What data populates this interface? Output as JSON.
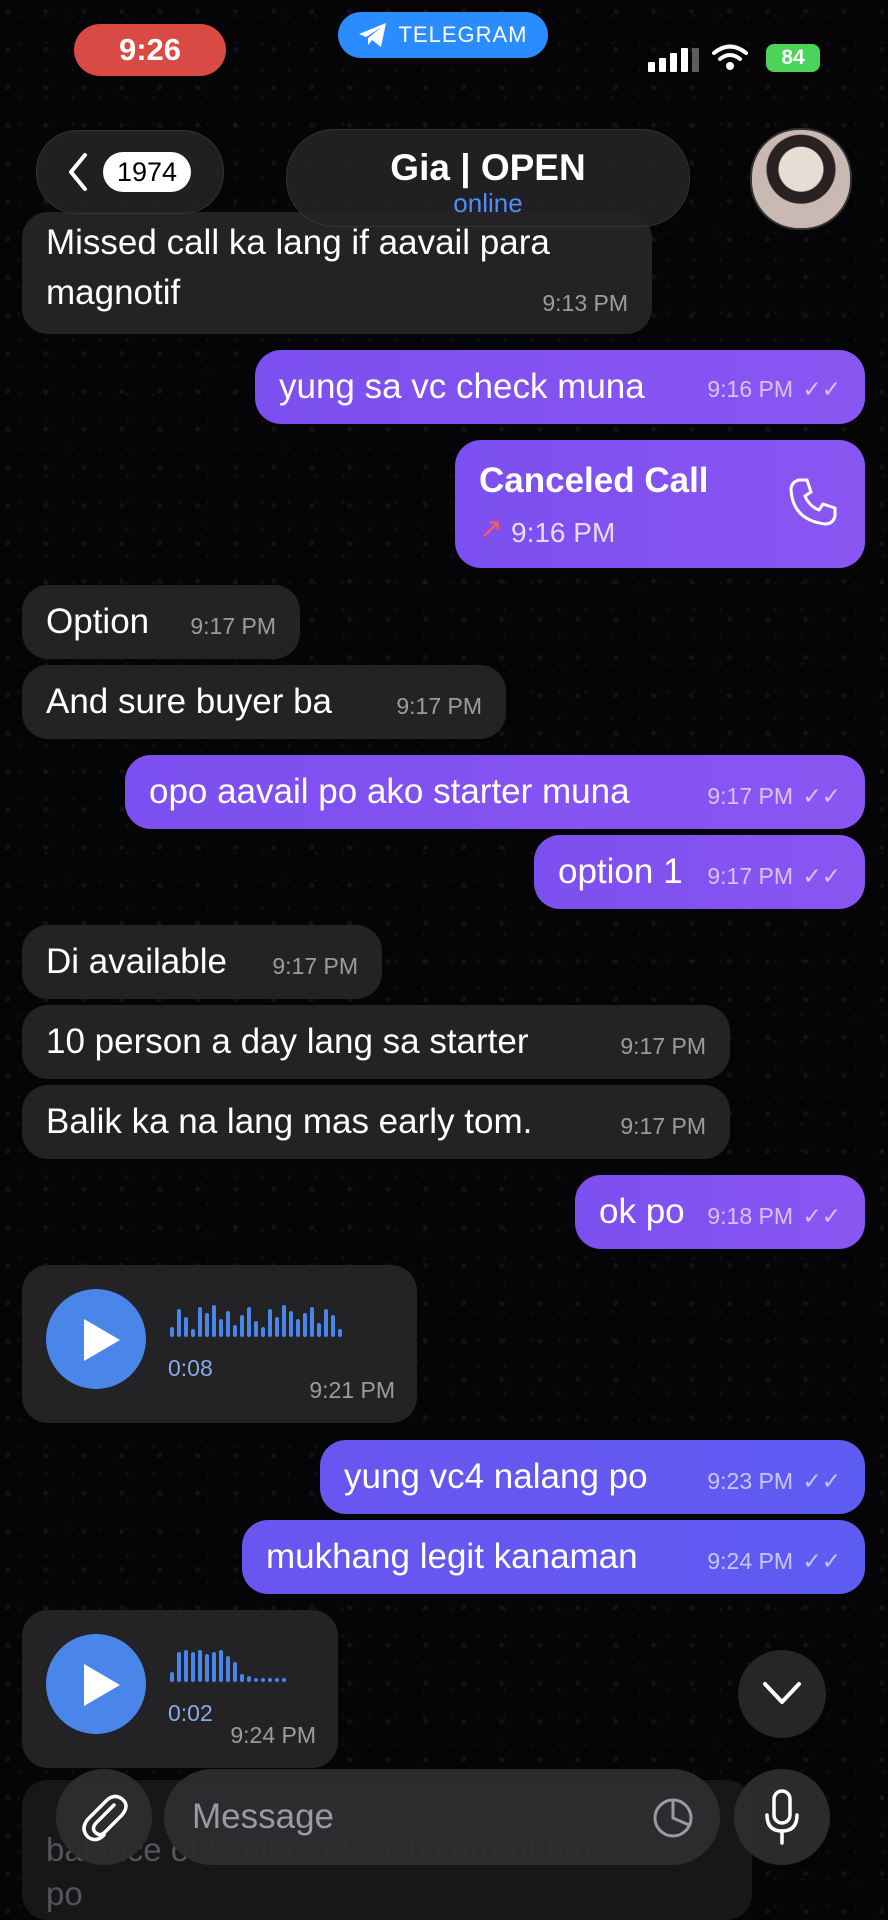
{
  "status_bar": {
    "time": "9:26",
    "app_pill": "TELEGRAM",
    "battery": "84"
  },
  "header": {
    "back_count": "1974",
    "chat_title": "Gia | OPEN",
    "chat_status": "online"
  },
  "messages": [
    {
      "dir": "in",
      "text_lines": [
        "Missed call ka lang if aavail para",
        "magnotif"
      ],
      "time": "9:13 PM"
    },
    {
      "dir": "out",
      "text": "yung sa vc check muna",
      "time": "9:16 PM"
    },
    {
      "dir": "out",
      "type": "call",
      "text": "Canceled Call",
      "time": "9:16 PM"
    },
    {
      "dir": "in",
      "text": "Option",
      "time": "9:17 PM"
    },
    {
      "dir": "in",
      "text": "And sure buyer ba",
      "time": "9:17 PM"
    },
    {
      "dir": "out",
      "text": "opo aavail po ako starter muna",
      "time": "9:17 PM"
    },
    {
      "dir": "out",
      "text": "option 1",
      "time": "9:17 PM"
    },
    {
      "dir": "in",
      "text": "Di available",
      "time": "9:17 PM"
    },
    {
      "dir": "in",
      "text": "10 person a day lang sa starter",
      "time": "9:17 PM"
    },
    {
      "dir": "in",
      "text": "Balik ka na lang mas early tom.",
      "time": "9:17 PM"
    },
    {
      "dir": "out",
      "text": "ok po",
      "time": "9:18 PM"
    },
    {
      "dir": "in",
      "type": "voice",
      "duration": "0:08",
      "time": "9:21 PM"
    },
    {
      "dir": "out",
      "text": "yung vc4 nalang po",
      "time": "9:23 PM"
    },
    {
      "dir": "out",
      "text": "mukhang legit kanaman",
      "time": "9:24 PM"
    },
    {
      "dir": "in",
      "type": "voice",
      "duration": "0:02",
      "time": "9:24 PM"
    }
  ],
  "composer": {
    "placeholder": "Message"
  },
  "behind_text": [
    "balance of kanit bank with current time",
    "po"
  ]
}
